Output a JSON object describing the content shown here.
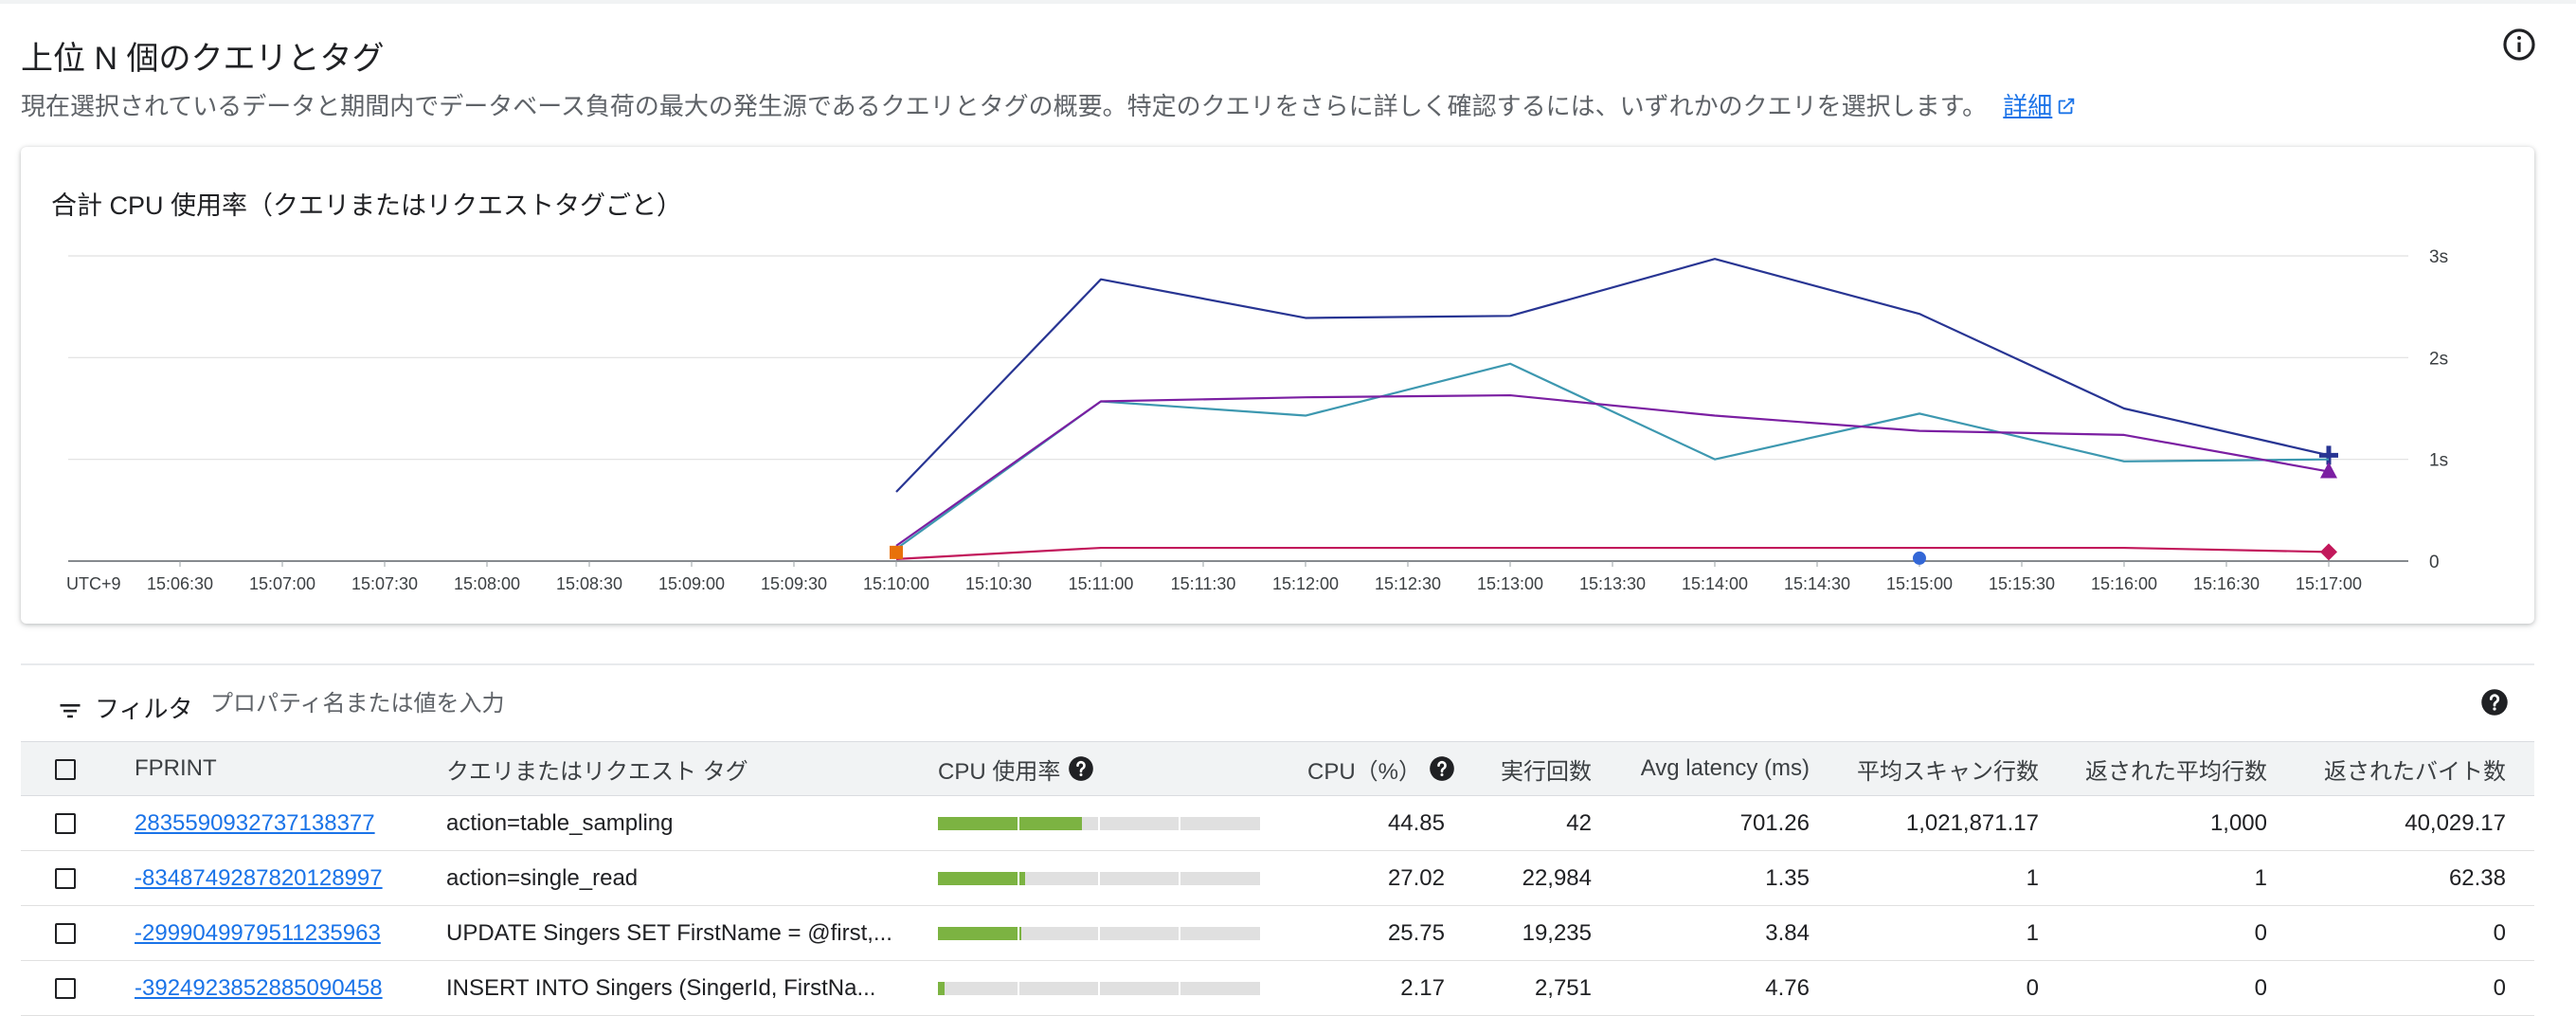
{
  "header": {
    "title": "上位 N 個のクエリとタグ",
    "description": "現在選択されているデータと期間内でデータベース負荷の最大の発生源であるクエリとタグの概要。特定のクエリをさらに詳しく確認するには、いずれかのクエリを選択します。",
    "details_link": "詳細"
  },
  "chart_title": "合計 CPU 使用率（クエリまたはリクエストタグごと）",
  "chart_data": {
    "type": "line",
    "x": [
      "15:10:00",
      "15:11:00",
      "15:12:00",
      "15:13:00",
      "15:14:00",
      "15:15:00",
      "15:16:00",
      "15:17:00"
    ],
    "x_ticks": [
      "UTC+9",
      "15:06:30",
      "15:07:00",
      "15:07:30",
      "15:08:00",
      "15:08:30",
      "15:09:00",
      "15:09:30",
      "15:10:00",
      "15:10:30",
      "15:11:00",
      "15:11:30",
      "15:12:00",
      "15:12:30",
      "15:13:00",
      "15:13:30",
      "15:14:00",
      "15:14:30",
      "15:15:00",
      "15:15:30",
      "15:16:00",
      "15:16:30",
      "15:17:00"
    ],
    "y_ticks": [
      "0",
      "1s",
      "2s",
      "3s"
    ],
    "ylim": [
      0,
      3
    ],
    "grid": true,
    "series": [
      {
        "color": "#283593",
        "values": [
          0.68,
          2.77,
          2.39,
          2.41,
          2.97,
          2.43,
          1.5,
          1.04
        ],
        "marker": "plus"
      },
      {
        "color": "#3d98b0",
        "values": [
          0.12,
          1.57,
          1.43,
          1.94,
          1.0,
          1.45,
          0.98,
          1.0
        ],
        "marker": "none"
      },
      {
        "color": "#7b1fa2",
        "values": [
          0.15,
          1.57,
          1.61,
          1.63,
          1.43,
          1.28,
          1.24,
          0.88
        ],
        "marker": "triangle"
      },
      {
        "color": "#c2185b",
        "values": [
          0.02,
          0.13,
          0.13,
          0.13,
          0.13,
          0.13,
          0.13,
          0.09
        ],
        "marker": "diamond"
      },
      {
        "color": "#e8710a",
        "values": [
          0.02,
          null,
          null,
          null,
          null,
          null,
          null,
          null
        ],
        "marker": "square"
      },
      {
        "color": "#3367d6",
        "values": [
          null,
          null,
          null,
          null,
          null,
          0.01,
          null,
          null
        ],
        "marker": "circle"
      }
    ]
  },
  "filter": {
    "label": "フィルタ",
    "placeholder": "プロパティ名または値を入力"
  },
  "table": {
    "columns": {
      "fprint": "FPRINT",
      "query": "クエリまたはリクエスト タグ",
      "cpu_usage": "CPU 使用率",
      "cpu_percent": "CPU（%）",
      "exec_count": "実行回数",
      "avg_latency": "Avg latency (ms)",
      "avg_scanned": "平均スキャン行数",
      "avg_returned": "返された平均行数",
      "bytes_returned": "返されたバイト数"
    },
    "rows": [
      {
        "fprint": "2835590932737138377",
        "query": "action=table_sampling",
        "cpu_fill": 0.4485,
        "cpu_percent": "44.85",
        "exec_count": "42",
        "avg_latency": "701.26",
        "avg_scanned": "1,021,871.17",
        "avg_returned": "1,000",
        "bytes_returned": "40,029.17"
      },
      {
        "fprint": "-8348749287820128997",
        "query": "action=single_read",
        "cpu_fill": 0.2702,
        "cpu_percent": "27.02",
        "exec_count": "22,984",
        "avg_latency": "1.35",
        "avg_scanned": "1",
        "avg_returned": "1",
        "bytes_returned": "62.38"
      },
      {
        "fprint": "-2999049979511235963",
        "query": "UPDATE Singers SET FirstName = @first,...",
        "cpu_fill": 0.2575,
        "cpu_percent": "25.75",
        "exec_count": "19,235",
        "avg_latency": "3.84",
        "avg_scanned": "1",
        "avg_returned": "0",
        "bytes_returned": "0"
      },
      {
        "fprint": "-3924923852885090458",
        "query": "INSERT INTO Singers (SingerId, FirstNa...",
        "cpu_fill": 0.0217,
        "cpu_percent": "2.17",
        "exec_count": "2,751",
        "avg_latency": "4.76",
        "avg_scanned": "0",
        "avg_returned": "0",
        "bytes_returned": "0"
      }
    ]
  }
}
